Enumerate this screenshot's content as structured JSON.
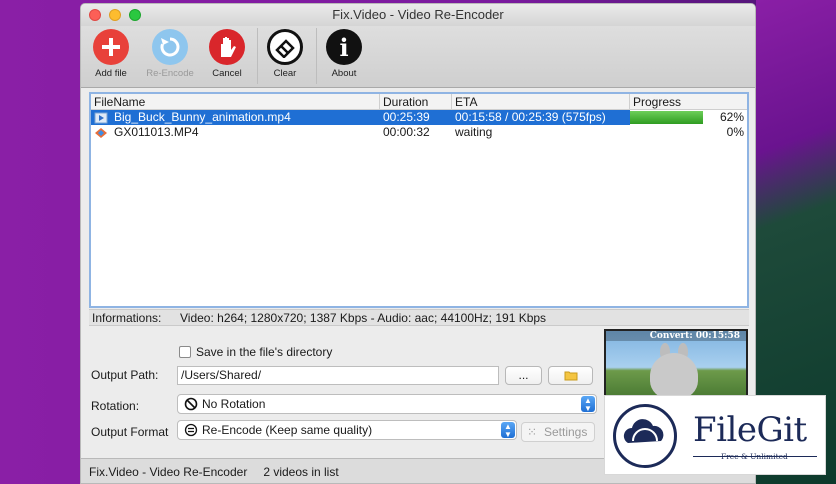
{
  "window": {
    "title": "Fix.Video - Video Re-Encoder"
  },
  "toolbar": {
    "add": "Add file",
    "reencode": "Re-Encode",
    "cancel": "Cancel",
    "clear": "Clear",
    "about": "About"
  },
  "table": {
    "headers": [
      "FileName",
      "Duration",
      "ETA",
      "Progress"
    ],
    "rows": [
      {
        "file": "Big_Buck_Bunny_animation.mp4",
        "duration": "00:25:39",
        "eta": "00:15:58 / 00:25:39 (575fps)",
        "progress": "62%",
        "progress_value": 0.62
      },
      {
        "file": "GX011013.MP4",
        "duration": "00:00:32",
        "eta": "waiting",
        "progress": "0%",
        "progress_value": 0
      }
    ]
  },
  "info": {
    "label": "Informations:",
    "value": "Video: h264; 1280x720; 1387 Kbps - Audio: aac; 44100Hz; 191 Kbps"
  },
  "options": {
    "save_in_dir": "Save in the file's directory",
    "output_path_label": "Output Path:",
    "output_path": "/Users/Shared/",
    "browse_btn": "...",
    "rotation_label": "Rotation:",
    "rotation": "No Rotation",
    "format_label": "Output Format",
    "format": "Re-Encode (Keep same quality)",
    "settings": "Settings"
  },
  "preview": {
    "overlay": "Convert: 00:15:58"
  },
  "status": {
    "app": "Fix.Video - Video Re-Encoder",
    "count": "2 videos in list"
  },
  "watermark": {
    "name": "FileGit",
    "tagline": "Free & Unlimited"
  },
  "colors": {
    "selection": "#1f6fd4",
    "progress": "#2f9c21"
  }
}
